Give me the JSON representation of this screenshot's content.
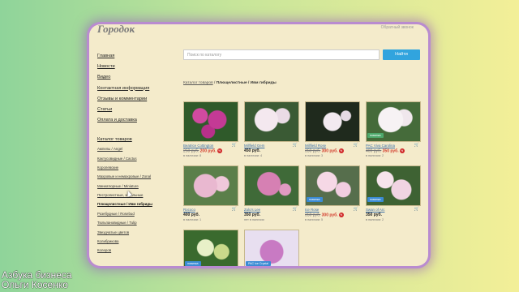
{
  "site": {
    "name": "Городок",
    "callback": "Обратный звонок"
  },
  "nav": [
    "Главная",
    "Новости",
    "Видео",
    "Контактная информация",
    "Отзывы и комментарии",
    "Статьи",
    "Оплата и доставка"
  ],
  "catalog": {
    "title": "Каталог товаров",
    "items": [
      "Ампелы / Angel",
      "Кактусовидные / Cactus",
      "Королевские",
      "Махровые и немахровые / Zonal",
      "Миниатюрные / Miniature",
      "Пестролистные, зональные",
      "Плющелистные / Ивм гибриды",
      "Розебудные / Rosebud",
      "Тюльпановидные / Tulip",
      "Звездчатые цветов",
      "Колибрикова",
      "Колеров"
    ],
    "active_index": 6
  },
  "search": {
    "placeholder": "Поиск по каталогу",
    "button": "Найти"
  },
  "breadcrumb": {
    "link": "Каталог товаров",
    "separator": " / ",
    "current": "Плющелистные / Ивм гибриды"
  },
  "products": [
    {
      "name": "Beatrice Cottington",
      "old_price": "250 руб.",
      "price": "200 руб.",
      "stock": "в наличии: 8",
      "badge": "",
      "sale": true
    },
    {
      "name": "Millfield Gem",
      "old_price": "",
      "price": "450 руб.",
      "stock": "в наличии: 4",
      "badge": "",
      "sale": false
    },
    {
      "name": "Millfield Rose",
      "old_price": "350 руб.",
      "price": "300 руб.",
      "stock": "в наличии: 3",
      "badge": "",
      "sale": true
    },
    {
      "name": "PAC Viva Carolina",
      "old_price": "400 руб.",
      "price": "350 руб.",
      "stock": "в наличии: 2",
      "badge": "новинка",
      "sale": true
    },
    {
      "name": "Rococo",
      "old_price": "",
      "price": "400 руб.",
      "stock": "в наличии: 1",
      "badge": "",
      "sale": false
    },
    {
      "name": "Zulu's Lee",
      "old_price": "",
      "price": "350 руб.",
      "stock": "нет в наличии",
      "badge": "",
      "sale": false
    },
    {
      "name": "Ice Rose",
      "old_price": "350 руб.",
      "price": "300 руб.",
      "stock": "в наличии: 5",
      "badge": "новинка",
      "sale": true
    },
    {
      "name": "Swan of Arc",
      "old_price": "",
      "price": "350 руб.",
      "stock": "в наличии: 2",
      "badge": "новинка",
      "sale": false
    },
    {
      "name": "",
      "old_price": "",
      "price": "",
      "stock": "",
      "badge": "новинка",
      "sale": false
    },
    {
      "name": "",
      "old_price": "",
      "price": "",
      "stock": "",
      "badge": "PAC Ice Crystal",
      "sale": false
    }
  ],
  "sale_label": "%",
  "cart_icon": "cart-icon",
  "colors": {
    "accent": "#31a4de",
    "sale": "#d23a2a",
    "badge": "#3b8bd4",
    "frame_glow": "#b98bd0"
  },
  "watermark": {
    "line1": "Азбука бизнеса",
    "line2": "Ольги Косенко"
  }
}
